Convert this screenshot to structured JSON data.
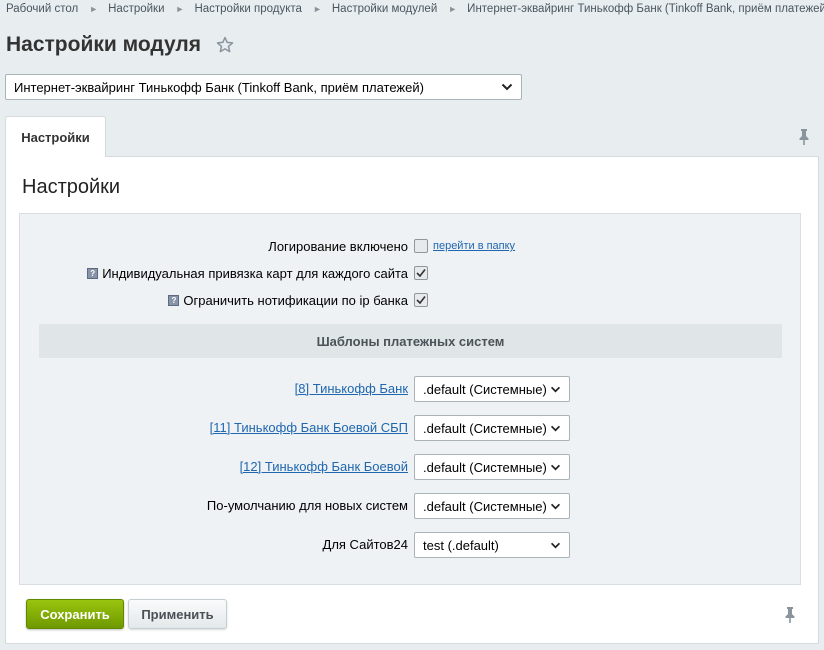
{
  "breadcrumb": [
    "Рабочий стол",
    "Настройки",
    "Настройки продукта",
    "Настройки модулей",
    "Интернет-эквайринг Тинькофф Банк (Tinkoff Bank, приём платежей)"
  ],
  "page_title": "Настройки модуля",
  "module_select": {
    "value": "Интернет-эквайринг Тинькофф Банк (Tinkoff Bank, приём платежей)"
  },
  "tabs": [
    {
      "label": "Настройки",
      "active": true
    }
  ],
  "panel": {
    "title": "Настройки",
    "options": {
      "logging": {
        "label": "Логирование включено",
        "checked": false,
        "link": "перейти в папку"
      },
      "card_binding": {
        "label": "Индивидуальная привязка карт для каждого сайта",
        "checked": true
      },
      "notify_ip": {
        "label": "Ограничить нотификации по ip банка",
        "checked": true
      }
    },
    "templates_section": {
      "title": "Шаблоны платежных систем",
      "rows": [
        {
          "label": "[8] Тинькофф Банк",
          "link": true,
          "value": ".default (Системные)"
        },
        {
          "label": "[11] Тинькофф Банк Боевой СБП",
          "link": true,
          "value": ".default (Системные)"
        },
        {
          "label": "[12] Тинькофф Банк Боевой",
          "link": true,
          "value": ".default (Системные)"
        },
        {
          "label": "По-умолчанию для новых систем",
          "link": false,
          "value": ".default (Системные)"
        },
        {
          "label": "Для Сайтов24",
          "link": false,
          "value": "test (.default)"
        }
      ]
    }
  },
  "buttons": {
    "save": "Сохранить",
    "apply": "Применить"
  },
  "colors": {
    "save_button": "#7fa800",
    "link": "#2067b0",
    "background": "#e8eef0"
  },
  "icons": [
    "star-icon",
    "pin-icon",
    "help-icon",
    "checkbox-check-icon",
    "chevron-down-icon"
  ]
}
